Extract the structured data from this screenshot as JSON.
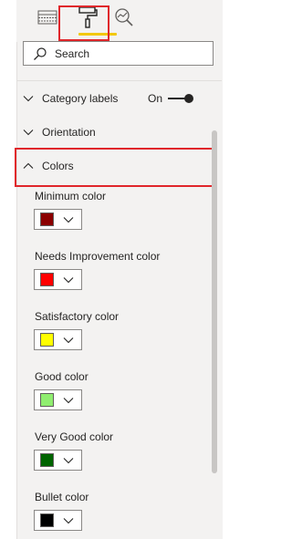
{
  "search": {
    "placeholder": "Search"
  },
  "sections": {
    "category_labels": {
      "label": "Category labels",
      "toggle_state": "On"
    },
    "orientation": {
      "label": "Orientation"
    },
    "colors": {
      "label": "Colors"
    }
  },
  "colors": {
    "minimum": {
      "label": "Minimum color",
      "value": "#8b0000"
    },
    "needs_improvement": {
      "label": "Needs Improvement color",
      "value": "#ff0000"
    },
    "satisfactory": {
      "label": "Satisfactory color",
      "value": "#ffff00"
    },
    "good": {
      "label": "Good color",
      "value": "#90ee70"
    },
    "very_good": {
      "label": "Very Good color",
      "value": "#006400"
    },
    "bullet": {
      "label": "Bullet color",
      "value": "#000000"
    }
  },
  "theme": {
    "highlight_box": "#e0262b",
    "active_tab_underline": "#f2c811"
  },
  "icons": {
    "fields_tab": "table-grid-icon",
    "format_tab": "paint-roller-icon",
    "analytics_tab": "magnifier-analytics-icon"
  }
}
